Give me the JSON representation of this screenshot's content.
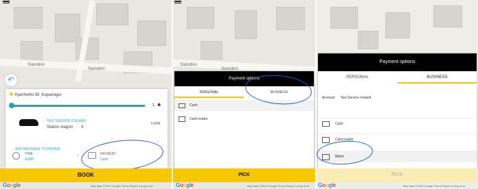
{
  "panel1": {
    "street1": "Slamdimi",
    "street2": "Slamdimi",
    "address": "Kjarrholmi 30, Kopavogur",
    "slider_value": "1",
    "company": "TAXI SERVICE ICELAND",
    "car_type": "Station wagon",
    "seats": "4",
    "eta": "5 MIN",
    "add_message": "ADD MESSAGE TO DRIVER",
    "time_label": "TIME",
    "time_value": "ASAP",
    "payment_label": "PAYMENT",
    "payment_value": "Cash",
    "book": "BOOK",
    "attribution": "Map data ©2023 Google   Terms   Report a map error"
  },
  "panel2": {
    "street1": "Slamdimi",
    "street2": "Slamdimi",
    "title": "Payment options",
    "tab_personal": "PERSONAL",
    "tab_business": "BUSINESS",
    "opt_cash": "Cash",
    "opt_card": "Card reader",
    "pick": "PICK",
    "attribution": "Map data ©2023 Google   Terms   Report a map error"
  },
  "panel3": {
    "title": "Payment options",
    "tab_personal": "PERSONAL",
    "tab_business": "BUSINESS",
    "account_label": "Account:",
    "account_value": "Taxi Service Iceland",
    "opt_cash": "Cash",
    "opt_card": "Card reader",
    "opt_billed": "Billed",
    "pick": "PICK",
    "attribution": "Map data ©2023 Google   Terms   Report a map error"
  },
  "colors": {
    "accent": "#f7c700",
    "teal": "#1aa7b3",
    "annotation": "#1a5fd1"
  }
}
